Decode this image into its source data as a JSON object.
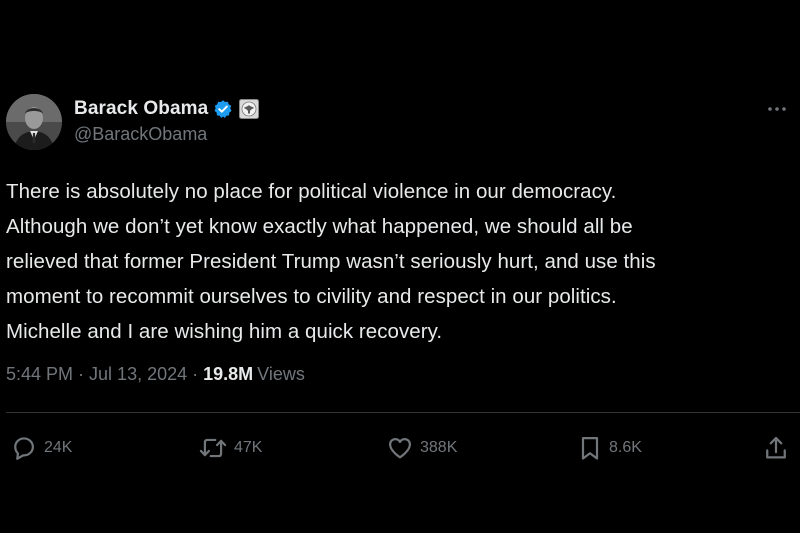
{
  "author": {
    "display_name": "Barack Obama",
    "handle": "@BarackObama",
    "verified_icon": "verified-badge-icon",
    "affiliation_icon": "government-seal-icon"
  },
  "tweet": {
    "lines": [
      "There is absolutely no place for political violence in our democracy.",
      "Although we don’t yet know exactly what happened, we should all be",
      "relieved that former President Trump wasn’t seriously hurt, and use this",
      "moment to recommit ourselves to civility and respect in our politics.",
      "Michelle and I are wishing him a quick recovery."
    ]
  },
  "meta": {
    "time": "5:44 PM",
    "separator": "·",
    "date": "Jul 13, 2024",
    "views_count": "19.8M",
    "views_label": "Views"
  },
  "actions": {
    "replies": "24K",
    "retweets": "47K",
    "likes": "388K",
    "bookmarks": "8.6K"
  },
  "colors": {
    "background": "#000000",
    "text": "#e7e9ea",
    "muted": "#71767b",
    "verified_blue": "#1d9bf0",
    "divider": "#2f3336"
  }
}
